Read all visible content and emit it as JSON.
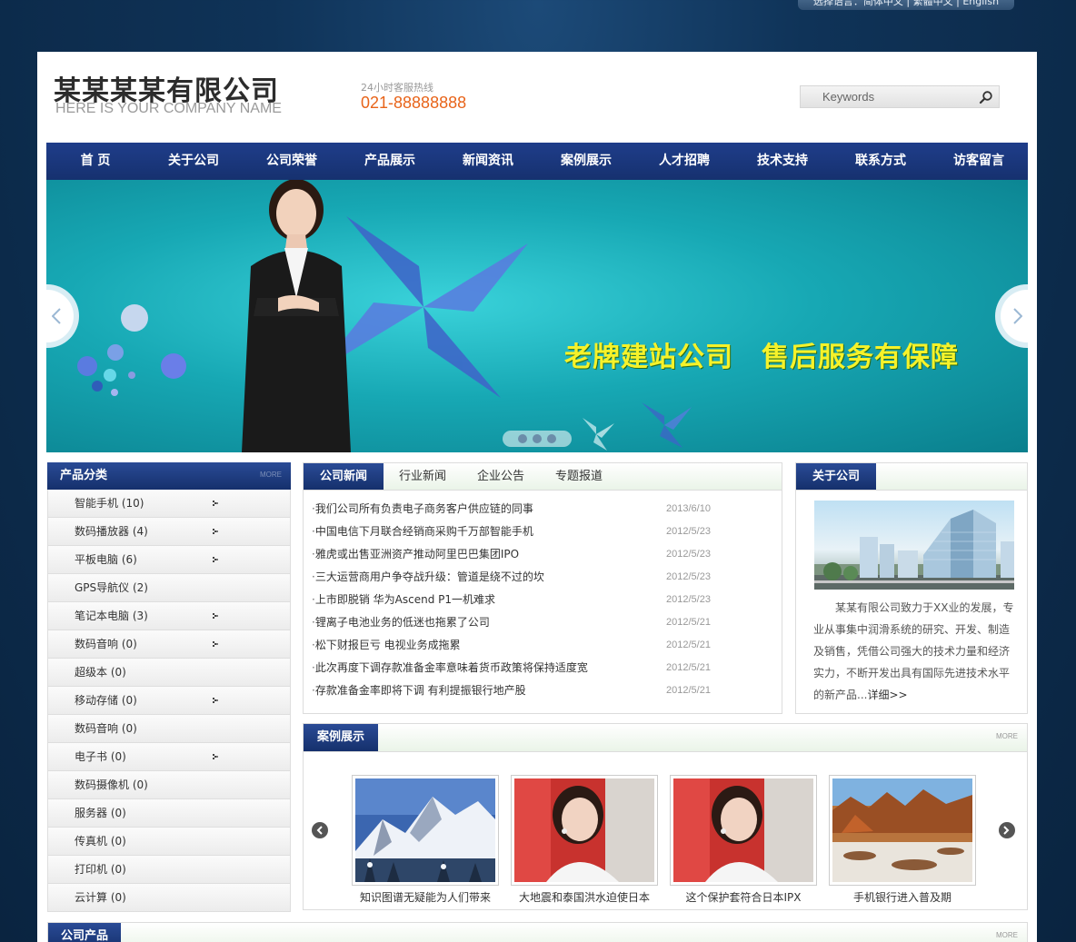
{
  "lang_bar": {
    "label": "选择语言：",
    "options": [
      "简体中文",
      "繁體中文",
      "English"
    ],
    "separator": " | "
  },
  "header": {
    "company_cn": "某某某某有限公司",
    "company_en": "HERE IS YOUR COMPANY NAME",
    "hotline_label": "24小时客服热线",
    "hotline_number": "021-88888888",
    "search_placeholder": "Keywords"
  },
  "nav": [
    "首 页",
    "关于公司",
    "公司荣誉",
    "产品展示",
    "新闻资讯",
    "案例展示",
    "人才招聘",
    "技术支持",
    "联系方式",
    "访客留言"
  ],
  "banner": {
    "slogan": "老牌建站公司　售后服务有保障",
    "slide_count": 3
  },
  "categories": {
    "title": "产品分类",
    "more": "MORE",
    "items": [
      {
        "label": "智能手机 (10)",
        "expandable": true
      },
      {
        "label": "数码播放器 (4)",
        "expandable": true
      },
      {
        "label": "平板电脑 (6)",
        "expandable": true
      },
      {
        "label": "GPS导航仪 (2)",
        "expandable": false
      },
      {
        "label": "笔记本电脑 (3)",
        "expandable": true
      },
      {
        "label": "数码音响 (0)",
        "expandable": true
      },
      {
        "label": "超级本 (0)",
        "expandable": false
      },
      {
        "label": "移动存储 (0)",
        "expandable": true
      },
      {
        "label": "数码音响 (0)",
        "expandable": false
      },
      {
        "label": "电子书 (0)",
        "expandable": true
      },
      {
        "label": "数码摄像机 (0)",
        "expandable": false
      },
      {
        "label": "服务器 (0)",
        "expandable": false
      },
      {
        "label": "传真机 (0)",
        "expandable": false
      },
      {
        "label": "打印机 (0)",
        "expandable": false
      },
      {
        "label": "云计算 (0)",
        "expandable": false
      }
    ]
  },
  "news": {
    "tabs": [
      "公司新闻",
      "行业新闻",
      "企业公告",
      "专题报道"
    ],
    "bullet": "·",
    "items": [
      {
        "title": "我们公司所有负责电子商务客户供应链的同事",
        "date": "2013/6/10"
      },
      {
        "title": "中国电信下月联合经销商采购千万部智能手机",
        "date": "2012/5/23"
      },
      {
        "title": "雅虎或出售亚洲资产推动阿里巴巴集团IPO",
        "date": "2012/5/23"
      },
      {
        "title": "三大运营商用户争夺战升级：管道是绕不过的坎",
        "date": "2012/5/23"
      },
      {
        "title": "上市即脱销 华为Ascend P1一机难求",
        "date": "2012/5/23"
      },
      {
        "title": "锂离子电池业务的低迷也拖累了公司",
        "date": "2012/5/21"
      },
      {
        "title": "松下财报巨亏 电视业务成拖累",
        "date": "2012/5/21"
      },
      {
        "title": "此次再度下调存款准备金率意味着货币政策将保持适度宽",
        "date": "2012/5/21"
      },
      {
        "title": "存款准备金率即将下调 有利提振银行地产股",
        "date": "2012/5/21"
      }
    ]
  },
  "about": {
    "title": "关于公司",
    "text": "某某有限公司致力于XX业的发展，专业从事集中润滑系统的研究、开发、制造及销售，凭借公司强大的技术力量和经济实力，不断开发出具有国际先进技术水平的新产品...",
    "more_link": "详细>>"
  },
  "cases": {
    "title": "案例展示",
    "more": "MORE",
    "items": [
      {
        "caption": "知识图谱无疑能为人们带来",
        "image": "snowy-mountain"
      },
      {
        "caption": "大地震和泰国洪水迫使日本",
        "image": "woman-portrait"
      },
      {
        "caption": "这个保护套符合日本IPX",
        "image": "woman-portrait"
      },
      {
        "caption": "手机银行进入普及期",
        "image": "red-rock-landscape"
      }
    ]
  },
  "products": {
    "title": "公司产品",
    "more": "MORE"
  }
}
